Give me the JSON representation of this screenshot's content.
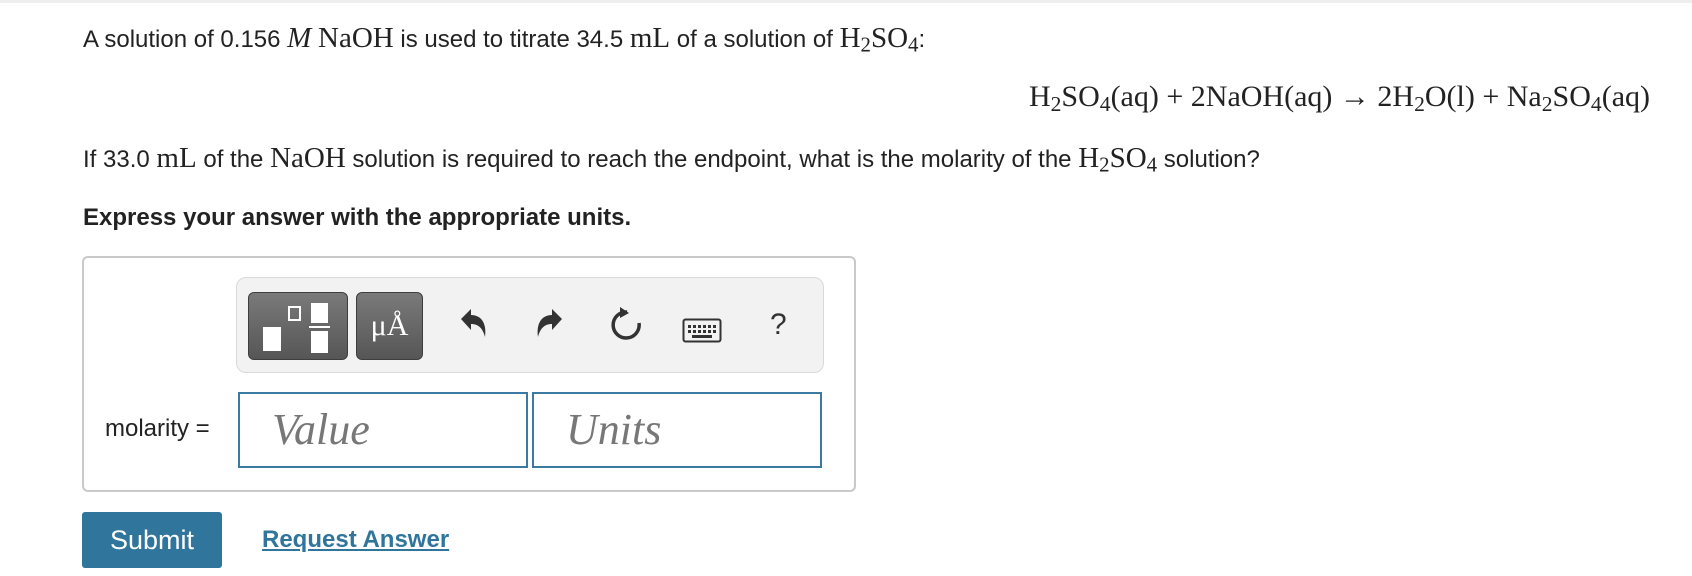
{
  "problem": {
    "p1_a": "A solution of 0.156 ",
    "p1_m": "M",
    "p1_naoh": "NaOH",
    "p1_b": " is used to titrate 34.5 ",
    "p1_ml": "mL",
    "p1_c": " of a solution of ",
    "p1_h2so4_h": "H",
    "p1_h2so4_2": "2",
    "p1_h2so4_so": "SO",
    "p1_h2so4_4": "4",
    "p1_colon": ":",
    "equation": {
      "t1": "H",
      "s1": "2",
      "t2": "SO",
      "s2": "4",
      "t3": "(aq) + 2NaOH(aq) → 2H",
      "s3": "2",
      "t4": "O(l) + Na",
      "s4": "2",
      "t5": "SO",
      "s5": "4",
      "t6": "(aq)"
    },
    "p2_a": "If 33.0 ",
    "p2_ml": "mL",
    "p2_b": " of the ",
    "p2_naoh": "NaOH",
    "p2_c": " solution is required to reach the endpoint, what is the molarity of the ",
    "p2_h": "H",
    "p2_2": "2",
    "p2_so": "SO",
    "p2_4": "4",
    "p2_d": " solution?",
    "instruction": "Express your answer with the appropriate units."
  },
  "toolbar": {
    "units_label": "μÅ",
    "help_label": "?",
    "icons": [
      "templates-icon",
      "units-icon",
      "undo-icon",
      "redo-icon",
      "reset-icon",
      "keyboard-icon",
      "help-icon"
    ]
  },
  "answer": {
    "label": "molarity =",
    "value_placeholder": "Value",
    "units_placeholder": "Units"
  },
  "actions": {
    "submit_label": "Submit",
    "request_label": "Request Answer"
  },
  "colors": {
    "accent": "#2f759c",
    "toolbar_button": "#666666"
  }
}
